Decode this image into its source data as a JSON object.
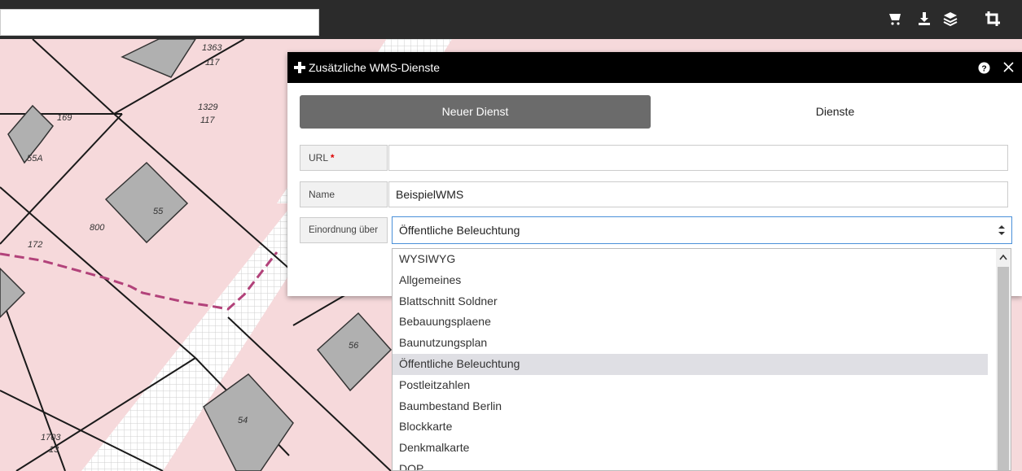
{
  "toolbar": {
    "search_value": "",
    "icons": [
      "cart-icon",
      "download-icon",
      "layers-icon",
      "crop-icon"
    ]
  },
  "map": {
    "parcel_labels": [
      "1363/117",
      "1329/117",
      "169",
      "55A",
      "55",
      "800",
      "172",
      "56",
      "54",
      "1703/13"
    ]
  },
  "dialog": {
    "title": "Zusätzliche WMS-Dienste",
    "tabs": {
      "new": "Neuer Dienst",
      "services": "Dienste"
    },
    "url": {
      "label": "URL",
      "required": "*",
      "value": ""
    },
    "name": {
      "label": "Name",
      "value": "BeispielWMS"
    },
    "category": {
      "label": "Einordnung über",
      "value": "Öffentliche Beleuchtung"
    }
  },
  "dropdown": {
    "options": [
      {
        "label": "WYSIWYG"
      },
      {
        "label": "Allgemeines"
      },
      {
        "label": "Blattschnitt Soldner"
      },
      {
        "label": "Bebauungsplaene"
      },
      {
        "label": "Baunutzungsplan"
      },
      {
        "label": "Öffentliche Beleuchtung",
        "selected": true
      },
      {
        "label": "Postleitzahlen"
      },
      {
        "label": "Baumbestand Berlin"
      },
      {
        "label": "Blockkarte"
      },
      {
        "label": "Denkmalkarte"
      },
      {
        "label": "DOP"
      }
    ]
  },
  "colors": {
    "map_bg": "#f6d9db",
    "topbar": "#2b2b2b",
    "header": "#000000",
    "tab_active": "#6b6b6b"
  }
}
